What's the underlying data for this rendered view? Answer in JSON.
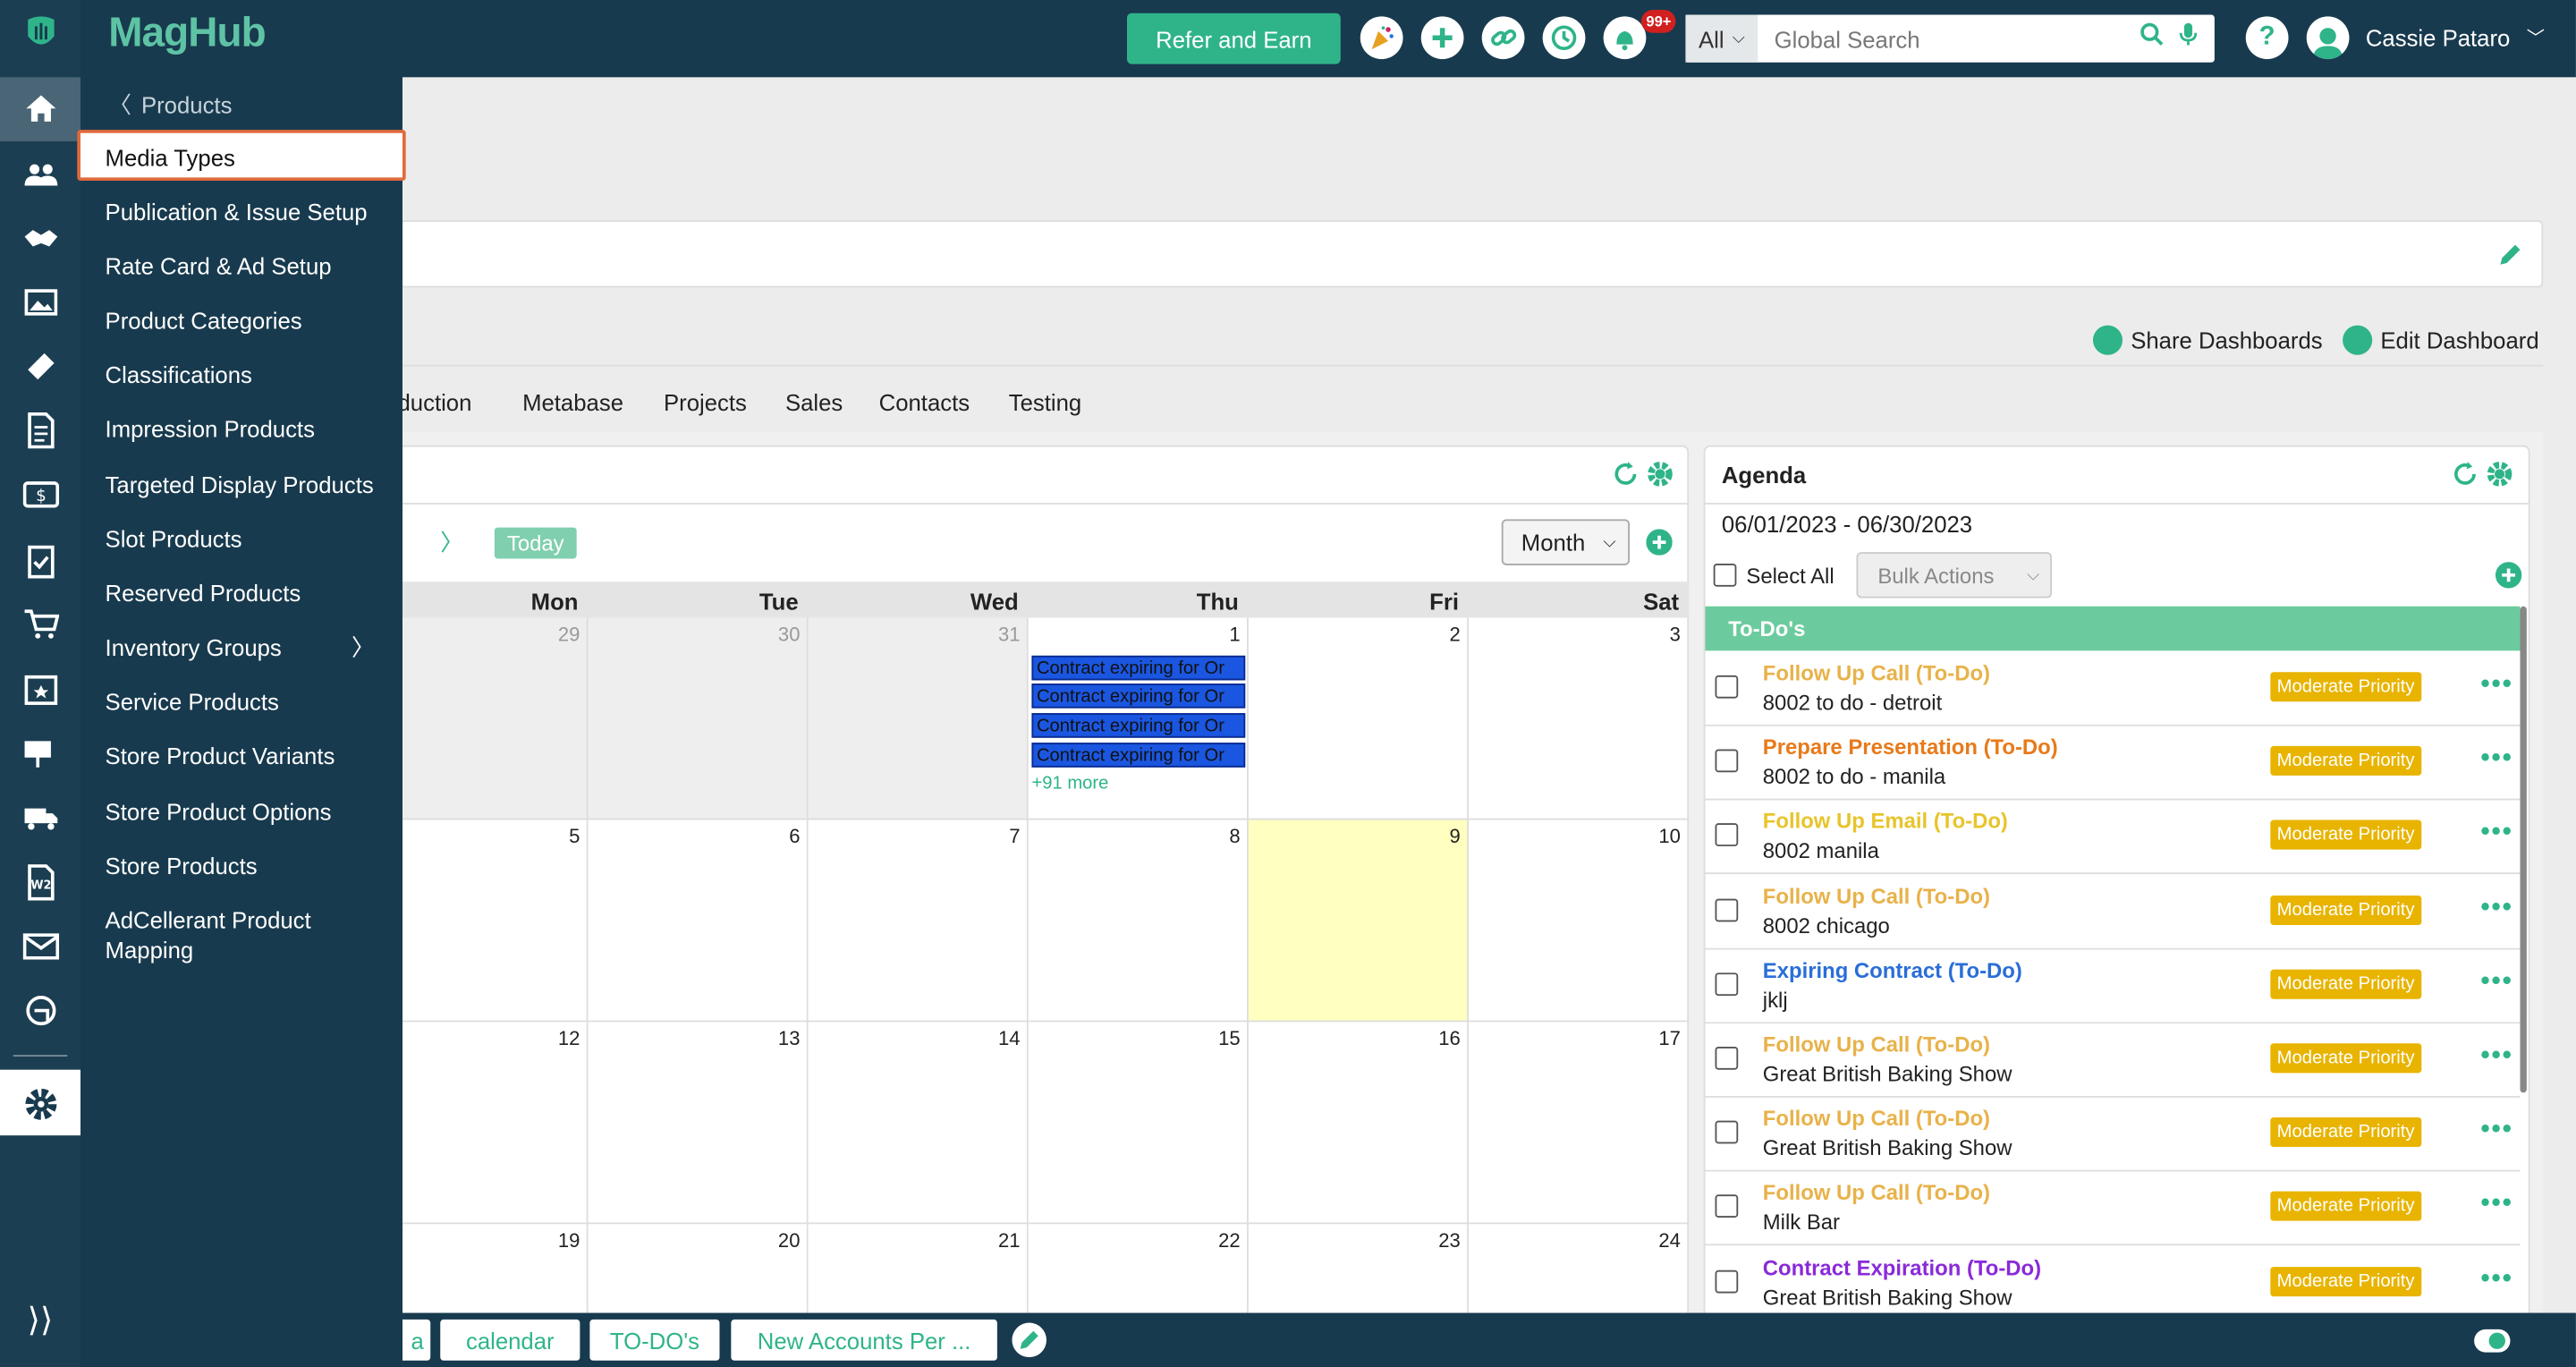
{
  "app": {
    "logo": "MagHub"
  },
  "topbar": {
    "refer_label": "Refer and Earn",
    "notification_count": "99+",
    "search_category": "All",
    "search_placeholder": "Global Search",
    "user_name": "Cassie Pataro"
  },
  "rail": {
    "items": [
      "home-icon",
      "contacts-icon",
      "handshake-icon",
      "image-icon",
      "ticket-icon",
      "document-icon",
      "money-icon",
      "clipboard-icon",
      "cart-icon",
      "calendar-star-icon",
      "mailbox-icon",
      "truck-icon",
      "w2-icon",
      "mail-icon",
      "support-icon",
      "settings-icon",
      "expand-icon"
    ],
    "active": "settings-icon"
  },
  "flyout": {
    "back_label": "Products",
    "items": [
      {
        "label": "Media Types",
        "selected": true
      },
      {
        "label": "Publication & Issue Setup"
      },
      {
        "label": "Rate Card & Ad Setup"
      },
      {
        "label": "Product Categories"
      },
      {
        "label": "Classifications"
      },
      {
        "label": "Impression Products"
      },
      {
        "label": "Targeted Display Products"
      },
      {
        "label": "Slot Products"
      },
      {
        "label": "Reserved Products"
      },
      {
        "label": "Inventory Groups",
        "has_submenu": true
      },
      {
        "label": "Service Products"
      },
      {
        "label": "Store Product Variants"
      },
      {
        "label": "Store Product Options"
      },
      {
        "label": "Store Products"
      },
      {
        "label": "AdCellerant Product Mapping"
      }
    ]
  },
  "dashboard": {
    "share_label": "Share Dashboards",
    "edit_label": "Edit Dashboard",
    "tabs": [
      "duction",
      "Metabase",
      "Projects",
      "Sales",
      "Contacts",
      "Testing"
    ]
  },
  "calendar": {
    "today_label": "Today",
    "view_label": "Month",
    "day_headers": [
      "Mon",
      "Tue",
      "Wed",
      "Thu",
      "Fri",
      "Sat"
    ],
    "weeks": [
      [
        "29",
        "30",
        "31",
        "1",
        "2",
        "3"
      ],
      [
        "5",
        "6",
        "7",
        "8",
        "9",
        "10"
      ],
      [
        "12",
        "13",
        "14",
        "15",
        "16",
        "17"
      ],
      [
        "19",
        "20",
        "21",
        "22",
        "23",
        "24"
      ]
    ],
    "events": [
      "Contract expiring for Or",
      "Contract expiring for Or",
      "Contract expiring for Or",
      "Contract expiring for Or"
    ],
    "more_label": "+91 more"
  },
  "agenda": {
    "title": "Agenda",
    "date_range": "06/01/2023 - 06/30/2023",
    "select_all": "Select All",
    "bulk_actions": "Bulk Actions",
    "section": "To-Do's",
    "items": [
      {
        "title": "Follow Up Call (To-Do)",
        "sub": "8002 to do - detroit",
        "color": "#e8b24a",
        "priority": "Moderate Priority"
      },
      {
        "title": "Prepare Presentation (To-Do)",
        "sub": "8002 to do - manila",
        "color": "#e87a1a",
        "priority": "Moderate Priority"
      },
      {
        "title": "Follow Up Email (To-Do)",
        "sub": "8002 manila",
        "color": "#e8c42a",
        "priority": "Moderate Priority"
      },
      {
        "title": "Follow Up Call (To-Do)",
        "sub": "8002 chicago",
        "color": "#e8b24a",
        "priority": "Moderate Priority"
      },
      {
        "title": "Expiring Contract (To-Do)",
        "sub": "jklj",
        "color": "#2a6ed8",
        "priority": "Moderate Priority"
      },
      {
        "title": "Follow Up Call (To-Do)",
        "sub": "Great British Baking Show",
        "color": "#e8b24a",
        "priority": "Moderate Priority"
      },
      {
        "title": "Follow Up Call (To-Do)",
        "sub": "Great British Baking Show",
        "color": "#e8b24a",
        "priority": "Moderate Priority"
      },
      {
        "title": "Follow Up Call (To-Do)",
        "sub": "Milk Bar",
        "color": "#e8b24a",
        "priority": "Moderate Priority"
      },
      {
        "title": "Contract Expiration (To-Do)",
        "sub": "Great British Baking Show",
        "color": "#8a2ad8",
        "priority": "Moderate Priority"
      }
    ]
  },
  "bottom_tabs": [
    "a",
    "calendar",
    "TO-DO's",
    "New Accounts Per ..."
  ],
  "colors": {
    "navy": "#183a4e",
    "accent": "#2fb48a",
    "priority": "#e8b400",
    "event": "#1a56e0",
    "today": "#ffffc0"
  }
}
